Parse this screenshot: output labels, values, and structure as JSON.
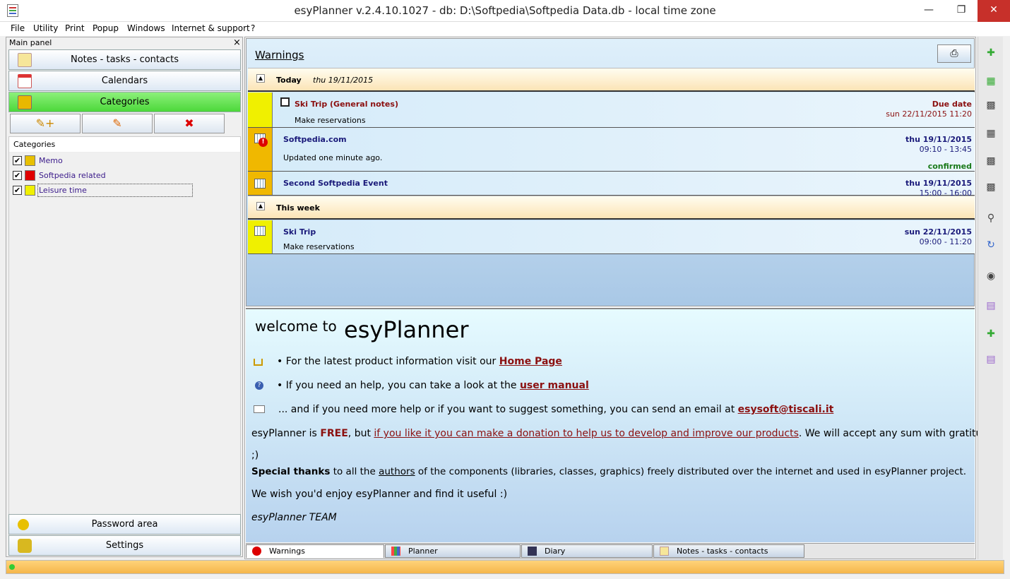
{
  "window": {
    "title": "esyPlanner v.2.4.10.1027 - db: D:\\Softpedia\\Softpedia Data.db - local time zone",
    "min": "—",
    "max": "❐",
    "close": "✕"
  },
  "menu": [
    "File",
    "Utility",
    "Print",
    "Popup",
    "Windows",
    "Internet & support",
    "?"
  ],
  "left_panel": {
    "title": "Main panel",
    "close": "×",
    "nav": [
      {
        "label": "Notes  -  tasks  -  contacts"
      },
      {
        "label": "Calendars"
      },
      {
        "label": "Categories"
      }
    ],
    "actions": {
      "add": "✎+",
      "edit": "✎",
      "delete": "✖"
    },
    "categories_header": "Categories",
    "categories": [
      {
        "name": "Memo",
        "color": "#e8c000",
        "checked": "✔"
      },
      {
        "name": "Softpedia related",
        "color": "#e00000",
        "checked": "✔"
      },
      {
        "name": "Leisure time",
        "color": "#f0f000",
        "checked": "✔"
      }
    ],
    "bottom_nav": [
      {
        "label": "Password area"
      },
      {
        "label": "Settings"
      }
    ]
  },
  "warnings": {
    "title": "Warnings",
    "print": "⎙",
    "today": {
      "label": "Today",
      "date": "thu 19/11/2015"
    },
    "this_week": {
      "label": "This week"
    },
    "events": [
      {
        "title": "Ski Trip (General notes)",
        "sub": "Make reservations",
        "right1": "Due date",
        "right2": "sun 22/11/2015 11:20",
        "color": "#f0f000"
      },
      {
        "title": "Softpedia.com",
        "sub": "Updated one minute ago.",
        "right1": "thu 19/11/2015",
        "right2": "09:10 - 13:45",
        "right3": "confirmed",
        "color": "#f0b800"
      },
      {
        "title": "Second Softpedia Event",
        "right1": "thu 19/11/2015",
        "right2": "15:00 - 16:00",
        "color": "#f0b800"
      },
      {
        "title": "Ski Trip",
        "sub": "Make reservations",
        "right1": "sun 22/11/2015",
        "right2": "09:00 - 11:20",
        "color": "#f0f000"
      }
    ]
  },
  "welcome": {
    "intro": "welcome to",
    "app": "esyPlanner",
    "l1": "• For the latest product information visit our ",
    "l1_link": "Home Page",
    "l2": "• If you need an help, you can take a look at the ",
    "l2_link": "user manual",
    "l3": "... and if you need more help or if you want to suggest something, you can send an email at ",
    "l3_link": "esysoft@tiscali.it",
    "l4a": "esyPlanner is ",
    "l4_free": "FREE",
    ", but ": "",
    "l4b": ", but ",
    "l4_link": "if you like it you can make a donation to help us to develop and improve our products",
    "l4c": ". We will accept any sum with gratitude",
    "l5": ";)",
    "l6_bold": "Special thanks",
    "l6a": " to all the ",
    "l6_link": "authors",
    "l6b": " of the components (libraries, classes, graphics) freely distributed over the internet and used in esyPlanner project.",
    "l7": "We wish you'd enjoy esyPlanner and find it useful :)",
    "l8": "esyPlanner TEAM"
  },
  "tabs": [
    {
      "label": "Warnings"
    },
    {
      "label": "Planner"
    },
    {
      "label": "Diary"
    },
    {
      "label": "Notes - tasks - contacts"
    }
  ]
}
